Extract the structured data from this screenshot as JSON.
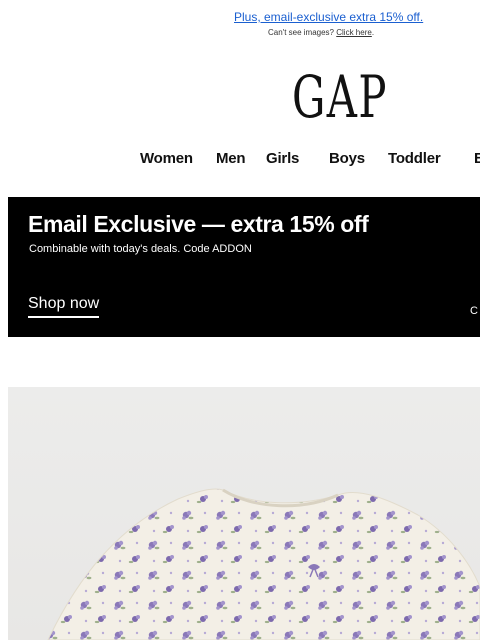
{
  "preheader": {
    "link_text": "Plus, email-exclusive extra 15% off.",
    "images_prompt": "Can't see images?",
    "images_link": "Click here",
    "images_suffix": "."
  },
  "brand": {
    "logo_text": "GAP"
  },
  "nav": {
    "items": [
      "Women",
      "Men",
      "Girls",
      "Boys",
      "Toddler",
      "B"
    ]
  },
  "banner": {
    "title": "Email Exclusive — extra 15% off",
    "subtitle": "Combinable with today's deals. Code ADDON",
    "cta": "Shop now",
    "edge_text": "C"
  },
  "hero": {
    "image": "floral-pajama-top-photo",
    "colors": {
      "fabric": "#f3efe6",
      "flower": "#8a78b8",
      "leaf": "#9fb08c",
      "bg": "#ebeae8"
    }
  }
}
